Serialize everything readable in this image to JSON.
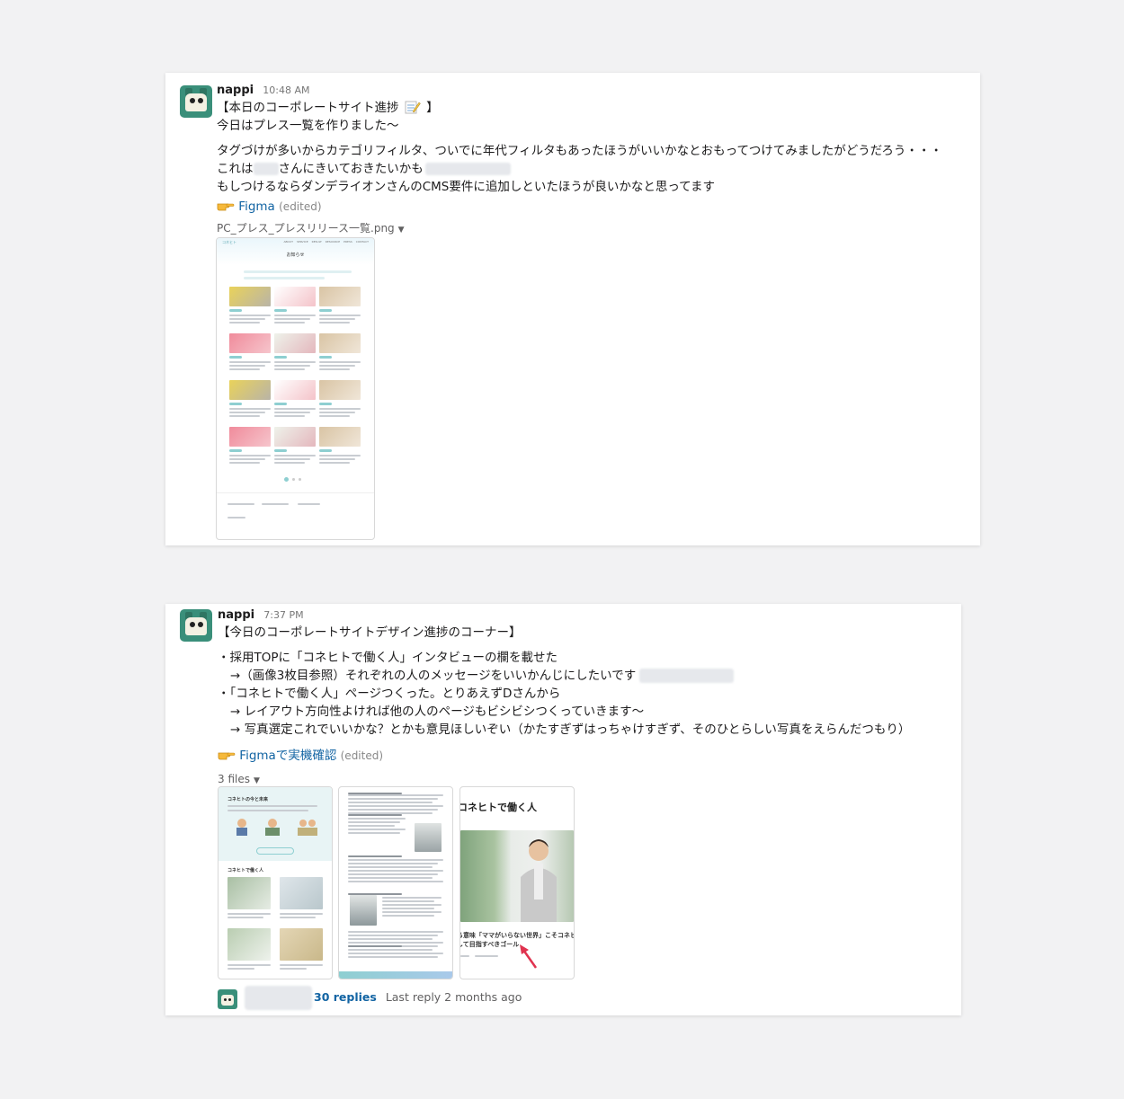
{
  "messages": [
    {
      "author": "nappi",
      "time": "10:48 AM",
      "lines": [
        "【本日のコーポレートサイト進捗",
        "】",
        "今日はプレス一覧を作りました〜",
        "タグづけが多いからカテゴリフィルタ、ついでに年代フィルタもあったほうがいいかなとおもってつけてみましたがどうだろう・・・",
        "これは",
        "さんにきいておきたいかも",
        "もしつけるならダンデライオンさんのCMS要件に追加しといたほうが良いかなと思ってます"
      ],
      "link_text": "Figma",
      "edited": "(edited)",
      "file_name": "PC_プレス_プレスリリース一覧.png",
      "preview": {
        "title": "お知らせ",
        "nav": [
          "ABOUT",
          "SERVICE",
          "RESULT",
          "RESOURCE",
          "PRESS",
          "CONTACT"
        ],
        "logo": "コネヒト"
      }
    },
    {
      "author": "nappi",
      "time": "7:37 PM",
      "lines": [
        "【今日のコーポレートサイトデザイン進捗のコーナー】",
        "・採用TOPに「コネヒトで働く人」インタビューの欄を載せた",
        "→（画像3枚目参照）それぞれの人のメッセージをいいかんじにしたいです",
        "・「コネヒトで働く人」ページつくった。とりあえずDさんから",
        "→ レイアウト方向性よければ他の人のページもビシビシつくっていきます〜",
        "→ 写真選定これでいいかな？とかも意見ほしいぞい（かたすぎずはっちゃけすぎず、そのひとらしい写真をえらんだつもり）"
      ],
      "link_text": "Figmaで実機確認",
      "edited": "(edited)",
      "files_label": "3 files",
      "thumb_labels": {
        "t1_head": "コネヒトの今と未来",
        "t1_sub": "コネヒトで働く人",
        "t3_title": "コネヒトで働く人",
        "t3_quote1": "る意味「ママがいらない世界」こそコネヒ",
        "t3_quote2": "して目指すべきゴール"
      },
      "replies_count": "30 replies",
      "last_reply": "Last reply 2 months ago"
    }
  ],
  "colors": {
    "link": "#1264a3",
    "accent_teal": "#8ecfd1",
    "avatar": "#3a8f7a"
  },
  "icons": [
    "avatar",
    "memo-icon",
    "pointing-hand-icon",
    "chevron-down-icon",
    "red-arrow-icon"
  ]
}
